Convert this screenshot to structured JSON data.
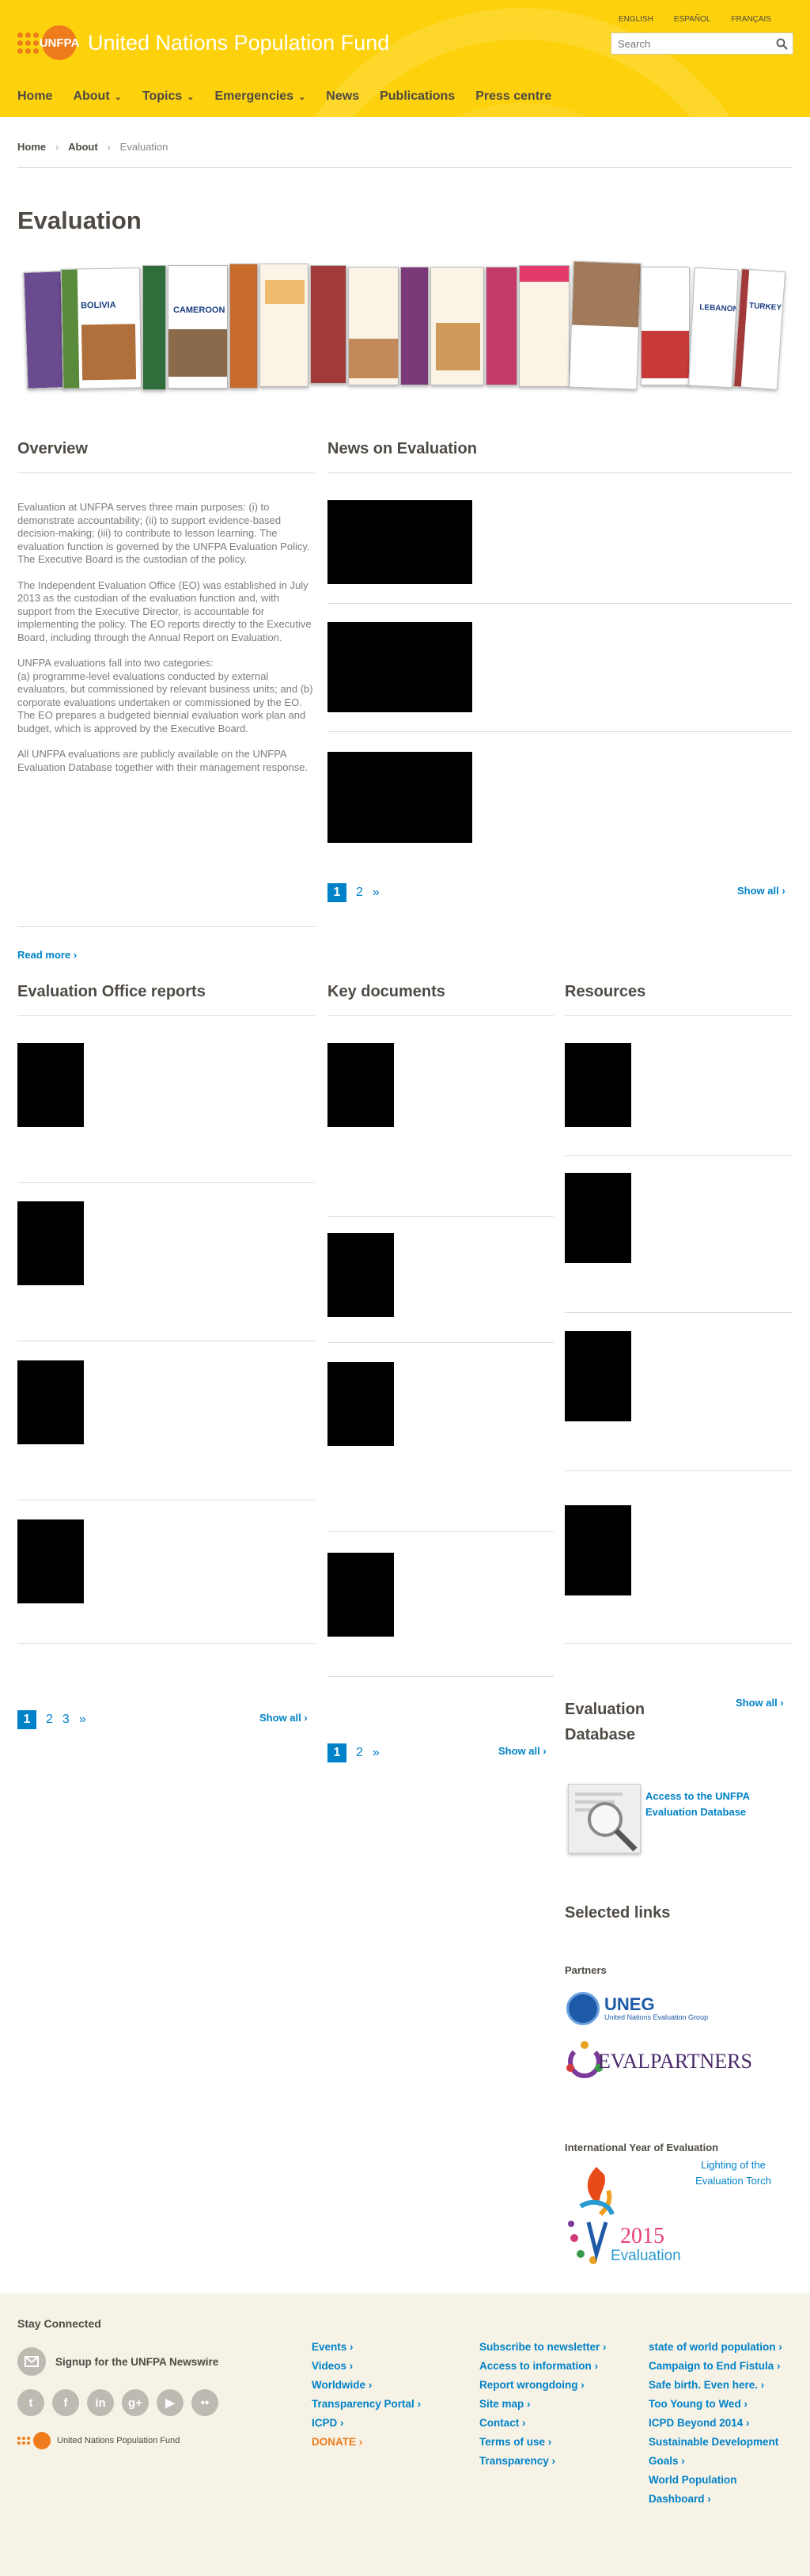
{
  "header": {
    "logo_text": "UNFPA",
    "site_name": "United Nations Population Fund",
    "languages": [
      "ENGLISH",
      "ESPAÑOL",
      "FRANÇAIS"
    ],
    "search_placeholder": "Search"
  },
  "nav": [
    {
      "label": "Home",
      "has_dropdown": false
    },
    {
      "label": "About",
      "has_dropdown": true
    },
    {
      "label": "Topics",
      "has_dropdown": true
    },
    {
      "label": "Emergencies",
      "has_dropdown": true
    },
    {
      "label": "News",
      "has_dropdown": false
    },
    {
      "label": "Publications",
      "has_dropdown": false
    },
    {
      "label": "Press centre",
      "has_dropdown": false
    }
  ],
  "breadcrumb": [
    "Home",
    "About",
    "Evaluation"
  ],
  "page_title": "Evaluation",
  "banner_covers": [
    "BOLIVIA",
    "CAMEROON",
    "LEBANON",
    "TURKEY"
  ],
  "overview": {
    "title": "Overview",
    "paragraphs": [
      "Evaluation at UNFPA serves three main purposes: (i) to demonstrate accountability; (ii) to support evidence-based decision-making; (iii) to contribute to lesson learning. The evaluation function is governed by the UNFPA Evaluation Policy. The Executive Board is the custodian of the policy.",
      "The Independent Evaluation Office (EO) was established in July 2013 as the custodian of the evaluation function and, with support from the Executive Director, is accountable for implementing the policy. The EO reports directly to the Executive Board, including through the Annual Report on Evaluation.",
      "UNFPA evaluations fall into two categories:",
      "(a) programme-level evaluations conducted by external evaluators, but commissioned by relevant business units; and (b) corporate evaluations undertaken or commissioned by the EO. The EO prepares a budgeted biennial evaluation work plan and budget, which is approved by the Executive Board.",
      "All UNFPA evaluations are publicly available on the UNFPA Evaluation Database together with their management response."
    ],
    "read_more": "Read more"
  },
  "news": {
    "title": "News on Evaluation",
    "pages": [
      "1",
      "2"
    ],
    "show_all": "Show all"
  },
  "office_reports": {
    "title": "Evaluation Office reports",
    "pages": [
      "1",
      "2",
      "3"
    ],
    "show_all": "Show all"
  },
  "key_documents": {
    "title": "Key documents",
    "pages": [
      "1",
      "2"
    ],
    "show_all": "Show all"
  },
  "resources": {
    "title": "Resources",
    "db_title": "Evaluation Database",
    "db_show_all": "Show all",
    "db_link": "Access to the UNFPA Evaluation Database",
    "selected_links": "Selected links",
    "partners": "Partners",
    "uneg": "UNEG",
    "uneg_sub": "United Nations Evaluation Group",
    "evalpartners": "EVALPARTNERS",
    "iye_title": "International Year of Evaluation",
    "iye_link": "Lighting of the Evaluation Torch",
    "iye_year": "2015",
    "iye_word": "Evaluation"
  },
  "footer": {
    "stay_connected": "Stay Connected",
    "newswire": "Signup for the UNFPA Newswire",
    "footer_logo": "United Nations Population Fund",
    "col1": [
      "Events",
      "Videos",
      "Worldwide",
      "Transparency Portal",
      "ICPD",
      "DONATE"
    ],
    "col2": [
      "Subscribe to newsletter",
      "Access to information",
      "Report wrongdoing",
      "Site map",
      "Contact",
      "Terms of use",
      "Transparency"
    ],
    "col3": [
      "state of world population",
      "Campaign to End Fistula",
      "Safe birth. Even here.",
      "Too Young to Wed",
      "ICPD Beyond 2014",
      "Sustainable Development Goals",
      "World Population Dashboard"
    ]
  },
  "colors": {
    "header_yellow": "#fdd20c",
    "accent_blue": "#0082c8",
    "orange": "#ef7c1c",
    "footer_bg": "#f6f2e6"
  }
}
